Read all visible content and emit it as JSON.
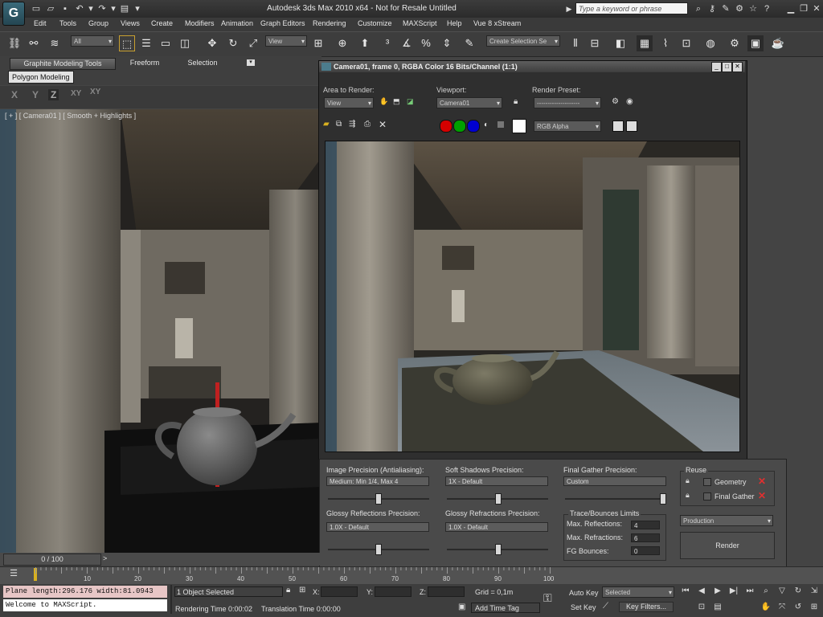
{
  "window": {
    "title": "Autodesk 3ds Max  2010 x64  -  Not for Resale   Untitled",
    "search_placeholder": "Type a keyword or phrase"
  },
  "menu": [
    "Edit",
    "Tools",
    "Group",
    "Views",
    "Create",
    "Modifiers",
    "Animation",
    "Graph Editors",
    "Rendering",
    "Customize",
    "MAXScript",
    "Help",
    "Vue 8 xStream"
  ],
  "toolbar": {
    "selection_filter": "All",
    "ref_coord": "View",
    "named_selection": "Create Selection Se"
  },
  "ribbon": {
    "tabs": [
      "Graphite Modeling Tools",
      "Freeform",
      "Selection"
    ],
    "panel_label": "Polygon Modeling",
    "axes": [
      "X",
      "Y",
      "Z",
      "XY",
      "XY"
    ]
  },
  "viewport": {
    "label": "[ + ] [ Camera01 ] [ Smooth + Highlights ]"
  },
  "render_window": {
    "title": "Camera01, frame 0, RGBA Color 16 Bits/Channel (1:1)",
    "area_label": "Area to Render:",
    "area_value": "View",
    "viewport_label": "Viewport:",
    "viewport_value": "Camera01",
    "preset_label": "Render Preset:",
    "preset_value": "--------------------",
    "channel_value": "RGB Alpha",
    "channel_colors": {
      "red": "#d40000",
      "green": "#00a000",
      "blue": "#0000d0"
    }
  },
  "render_settings": {
    "image_precision_label": "Image Precision (Antialiasing):",
    "image_precision_value": "Medium: Min 1/4, Max 4",
    "soft_shadows_label": "Soft Shadows Precision:",
    "soft_shadows_value": "1X - Default",
    "final_gather_label": "Final Gather Precision:",
    "final_gather_value": "Custom",
    "glossy_refl_label": "Glossy Reflections Precision:",
    "glossy_refl_value": "1.0X - Default",
    "glossy_refr_label": "Glossy Refractions Precision:",
    "glossy_refr_value": "1.0X - Default",
    "trace_label": "Trace/Bounces Limits",
    "max_refl_label": "Max. Reflections:",
    "max_refl_value": "4",
    "max_refr_label": "Max. Refractions:",
    "max_refr_value": "6",
    "fg_bounces_label": "FG Bounces:",
    "fg_bounces_value": "0",
    "reuse_label": "Reuse",
    "geometry_label": "Geometry",
    "final_gather_reuse_label": "Final Gather",
    "mode_value": "Production",
    "render_label": "Render"
  },
  "timeline": {
    "frame_indicator": "0 / 100",
    "ticks": [
      "10",
      "20",
      "30",
      "40",
      "50",
      "60",
      "70",
      "80",
      "90",
      "100"
    ]
  },
  "status": {
    "maxscript_output": "Plane length:296.176 width:81.0943",
    "maxscript_listener": "Welcome to MAXScript.",
    "selection_info": "1 Object Selected",
    "render_time": "Rendering Time  0:00:02",
    "translation_time": "Translation Time  0:00:00",
    "x_label": "X:",
    "y_label": "Y:",
    "z_label": "Z:",
    "grid": "Grid = 0,1m",
    "add_time_tag": "Add Time Tag",
    "auto_key": "Auto Key",
    "set_key": "Set Key",
    "key_mode_value": "Selected",
    "key_filters": "Key Filters..."
  }
}
